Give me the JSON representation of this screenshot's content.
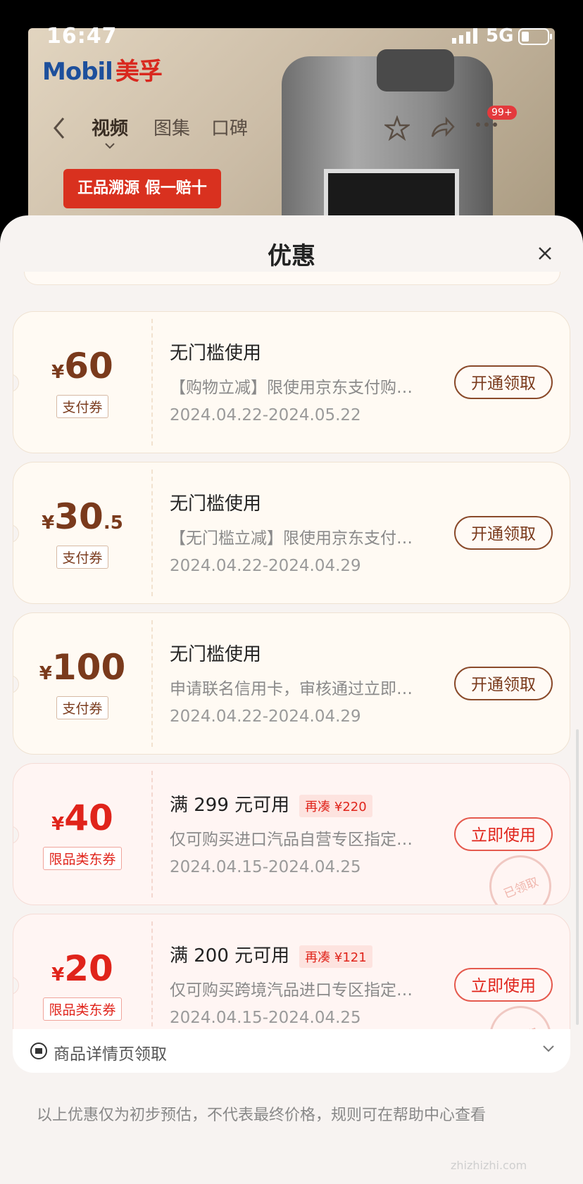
{
  "status_bar": {
    "time": "16:47",
    "network": "5G"
  },
  "background": {
    "brand_en": "Mobil",
    "brand_cn": "美孚",
    "nav_tabs": [
      "视频",
      "图集",
      "口碑"
    ],
    "badge": "99+",
    "banner": "正品溯源 假一赔十"
  },
  "sheet": {
    "title": "优惠"
  },
  "coupons": [
    {
      "currency": "¥",
      "amount": "60",
      "decimal": "",
      "tag": "支付券",
      "title": "无门槛使用",
      "topup": "",
      "desc": "【购物立减】限使用京东支付购买指定商品",
      "date": "2024.04.22-2024.05.22",
      "button": "开通领取",
      "style": "gold"
    },
    {
      "currency": "¥",
      "amount": "30",
      "decimal": ".5",
      "tag": "支付券",
      "title": "无门槛使用",
      "topup": "",
      "desc": "【无门槛立减】限使用京东支付购买指定商品",
      "date": "2024.04.22-2024.04.29",
      "button": "开通领取",
      "style": "gold"
    },
    {
      "currency": "¥",
      "amount": "100",
      "decimal": "",
      "tag": "支付券",
      "title": "无门槛使用",
      "topup": "",
      "desc": "申请联名信用卡，审核通过立即发放",
      "date": "2024.04.22-2024.04.29",
      "button": "开通领取",
      "style": "gold"
    },
    {
      "currency": "¥",
      "amount": "40",
      "decimal": "",
      "tag": "限品类东券",
      "title": "满 299 元可用",
      "topup": "再凑 ¥220",
      "desc": "仅可购买进口汽品自营专区指定商品",
      "date": "2024.04.15-2024.04.25",
      "button": "立即使用",
      "style": "red",
      "stamp": "已领取"
    },
    {
      "currency": "¥",
      "amount": "20",
      "decimal": "",
      "tag": "限品类东券",
      "title": "满 200 元可用",
      "topup": "再凑 ¥121",
      "desc": "仅可购买跨境汽品进口专区指定商品",
      "date": "2024.04.15-2024.04.25",
      "button": "立即使用",
      "style": "red",
      "stamp": "已领取"
    }
  ],
  "source": {
    "label": "商品详情页领取"
  },
  "disclaimer": "以上优惠仅为初步预估，不代表最终价格，规则可在帮助中心查看",
  "watermark": "zhizhizhi.com"
}
